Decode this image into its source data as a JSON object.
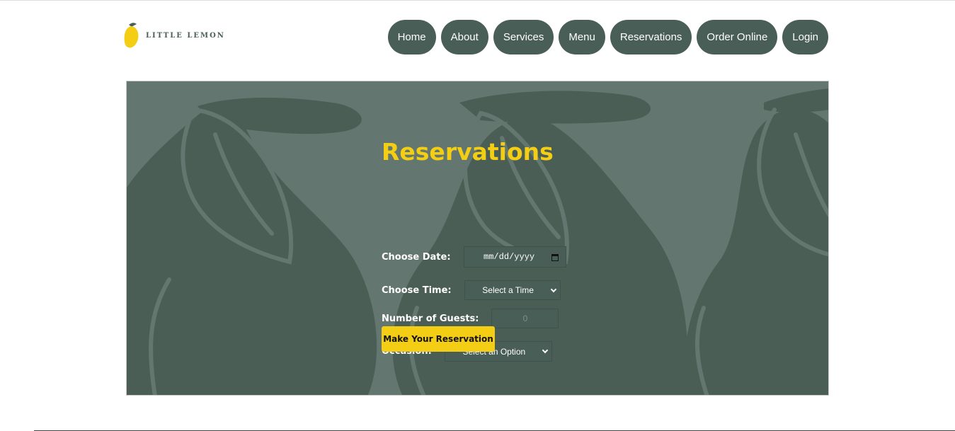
{
  "brand": {
    "name": "LITTLE LEMON",
    "logo_icon": "lemon-icon",
    "lemon_color": "#f4ce14",
    "leaf_color": "#495e57"
  },
  "nav": {
    "items": [
      {
        "label": "Home"
      },
      {
        "label": "About"
      },
      {
        "label": "Services"
      },
      {
        "label": "Menu"
      },
      {
        "label": "Reservations"
      },
      {
        "label": "Order Online"
      },
      {
        "label": "Login"
      }
    ]
  },
  "reservation": {
    "title": "Reservations",
    "date": {
      "label": "Choose Date:",
      "placeholder": "mm/dd/yyyy",
      "icon": "calendar-icon"
    },
    "time": {
      "label": "Choose Time:",
      "selected": "Select a Time"
    },
    "guests": {
      "label": "Number of Guests:",
      "placeholder": "0"
    },
    "occasion": {
      "label": "Occasion:",
      "selected": "Select an Option"
    },
    "submit_label": "Make Your Reservation"
  },
  "colors": {
    "primary_green": "#495e57",
    "accent_yellow": "#f4ce14",
    "hero_bg": "#63766f"
  }
}
